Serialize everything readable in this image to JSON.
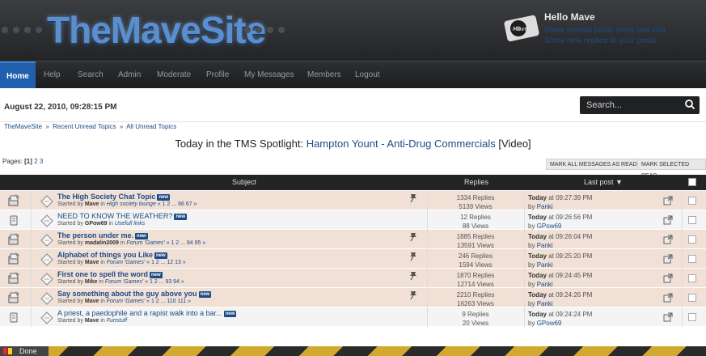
{
  "site": {
    "logo": "TheMaveSite"
  },
  "user": {
    "hello": "Hello Mave",
    "link1": "Show unread posts since last visit",
    "link2": "Show new replies to your posts",
    "avatar_text": "Mave"
  },
  "nav": [
    "Home",
    "Help",
    "Search",
    "Admin",
    "Moderate",
    "Profile",
    "My Messages",
    "Members",
    "Logout"
  ],
  "date": "August 22, 2010, 09:28:15 PM",
  "search": {
    "placeholder": "Search..."
  },
  "breadcrumb": [
    "TheMaveSite",
    "Recent Unread Topics",
    "All Unread Topics"
  ],
  "breadcrumb_sep": "»",
  "spotlight": {
    "prefix": "Today in the TMS Spotlight:",
    "link": "Hampton Yount - Anti-Drug Commercials",
    "suffix": "[Video]"
  },
  "pages": {
    "label": "Pages:",
    "current": "[1]",
    "others": [
      "2",
      "3"
    ]
  },
  "buttons": {
    "mark_all": "MARK ALL MESSAGES AS READ",
    "mark_selected": "MARK SELECTED READ"
  },
  "table": {
    "subject_header": "Subject",
    "replies_header": "Replies",
    "lastpost_header": "Last post ▼",
    "new_badge": "new",
    "rows": [
      {
        "title": "The High Society Chat Topic",
        "started_by": "Started by",
        "author": "Mave",
        "in": "in",
        "board": "High society lounge",
        "pages": "« 1 2 ... 66 67 »",
        "replies": "1334 Replies",
        "views": "5139 Views",
        "last_time": "Today",
        "last_rest": "at 09:27:39 PM",
        "last_by": "by",
        "last_user": "Panki",
        "sticky": true
      },
      {
        "title": "NEED TO KNOW THE WEATHER?",
        "started_by": "Started by",
        "author": "GPow69",
        "in": "in",
        "board": "Usefull links",
        "pages": "",
        "replies": "12 Replies",
        "views": "88 Views",
        "last_time": "Today",
        "last_rest": "at 09:26:56 PM",
        "last_by": "by",
        "last_user": "GPow69",
        "sticky": false
      },
      {
        "title": "The person under me.",
        "started_by": "Started by",
        "author": "madalin2009",
        "in": "in",
        "board": "Forum 'Games'",
        "pages": "« 1 2 ... 94 95 »",
        "replies": "1885 Replies",
        "views": "13591 Views",
        "last_time": "Today",
        "last_rest": "at 09:26:04 PM",
        "last_by": "by",
        "last_user": "Panki",
        "sticky": true
      },
      {
        "title": "Alphabet of things you Like",
        "started_by": "Started by",
        "author": "Mave",
        "in": "in",
        "board": "Forum 'Games'",
        "pages": "« 1 2 ... 12 13 »",
        "replies": "246 Replies",
        "views": "1594 Views",
        "last_time": "Today",
        "last_rest": "at 09:25:20 PM",
        "last_by": "by",
        "last_user": "Panki",
        "sticky": true
      },
      {
        "title": "First one to spell the word",
        "started_by": "Started by",
        "author": "Mike",
        "in": "in",
        "board": "Forum 'Games'",
        "pages": "« 1 2 ... 93 94 »",
        "replies": "1870 Replies",
        "views": "12714 Views",
        "last_time": "Today",
        "last_rest": "at 09:24:45 PM",
        "last_by": "by",
        "last_user": "Panki",
        "sticky": true
      },
      {
        "title": "Say something about the guy above you",
        "started_by": "Started by",
        "author": "Mave",
        "in": "in",
        "board": "Forum 'Games'",
        "pages": "« 1 2 ... 110 111 »",
        "replies": "2210 Replies",
        "views": "16263 Views",
        "last_time": "Today",
        "last_rest": "at 09:24:26 PM",
        "last_by": "by",
        "last_user": "Panki",
        "sticky": true
      },
      {
        "title": "A priest, a paedophile and a rapist walk into a bar...",
        "started_by": "Started by",
        "author": "Mave",
        "in": "in",
        "board": "Funstuff",
        "pages": "",
        "replies": "9 Replies",
        "views": "20 Views",
        "last_time": "Today",
        "last_rest": "at 09:24:24 PM",
        "last_by": "by",
        "last_user": "GPow69",
        "sticky": false
      }
    ]
  },
  "status": {
    "text": "Done"
  },
  "colors": {
    "accent": "#1f5fae",
    "link": "#1c4b86",
    "sticky_row": "#f0e0d5",
    "normal_row": "#f4f4f4",
    "header_bg": "#232426"
  }
}
